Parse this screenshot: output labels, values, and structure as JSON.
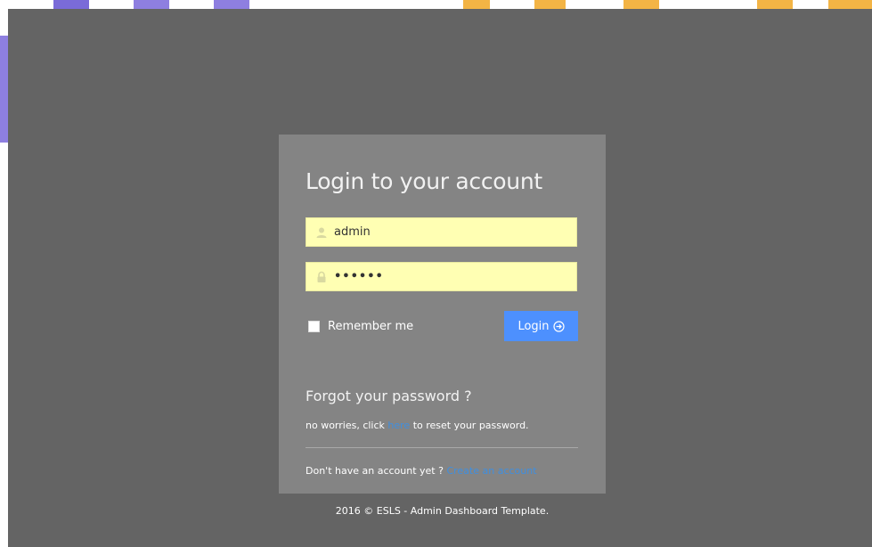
{
  "login": {
    "title": "Login to your account",
    "username_value": "admin",
    "password_value": "••••••",
    "remember_label": "Remember me",
    "login_button_label": "Login",
    "forgot_title": "Forgot your password ?",
    "forgot_text_before": "no worries, click ",
    "forgot_link": "here",
    "forgot_text_after": " to reset your password.",
    "signup_prompt": "Don't have an account yet ? ",
    "signup_link": "Create an account"
  },
  "footer": {
    "text": "2016 © ESLS - Admin Dashboard Template."
  },
  "icons": {
    "username": "user-icon",
    "password": "lock-icon",
    "login_button": "arrow-right-circle-icon"
  },
  "colors": {
    "page_background": "#646464",
    "panel_background": "#848484",
    "input_background": "#ffffb3",
    "primary_button": "#4d90fe",
    "link": "#3f8fe0"
  }
}
